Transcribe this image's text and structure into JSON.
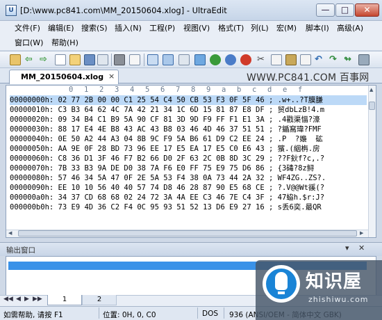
{
  "window": {
    "title": "[D:\\www.pc841.com\\MM_20150604.xlog] - UltraEdit",
    "app_icon": "U",
    "minimize_glyph": "—",
    "maximize_glyph": "□",
    "close_glyph": "✕"
  },
  "menu": {
    "row1": [
      "文件(F)",
      "编辑(E)",
      "搜索(S)",
      "插入(N)",
      "工程(P)",
      "视图(V)",
      "格式(T)",
      "列(L)",
      "宏(M)",
      "脚本(I)",
      "高级(A)"
    ],
    "row2": [
      "窗口(W)",
      "帮助(H)"
    ]
  },
  "toolbar": {
    "icons": [
      "new-file-icon",
      "back-arrow-icon",
      "forward-arrow-icon",
      "open-file-icon",
      "open-folder-icon",
      "save-icon",
      "print-icon",
      "print-preview-icon",
      "hex-mode-icon",
      "column-mode-icon",
      "find-icon",
      "find-next-icon",
      "replace-icon",
      "bookmark-icon",
      "fold-icon",
      "help-icon",
      "cut-icon",
      "copy-icon",
      "paste-icon",
      "undo-icon",
      "macro-record-icon",
      "macro-play-icon",
      "tools-icon"
    ]
  },
  "tab": {
    "label": "MM_20150604.xlog",
    "close_glyph": "×"
  },
  "watermark": "WWW.PC841.COM 百事网",
  "ruler": [
    "0",
    "1",
    "2",
    "3",
    "4",
    "5",
    "6",
    "7",
    "8",
    "9",
    "a",
    "b",
    "c",
    "d",
    "e",
    "f"
  ],
  "hex_rows": [
    {
      "addr": "00000000h:",
      "bytes": "02 77 2B 00 00 C1 25 54 C4 50 CB 53 F3 0F 5F 46",
      "text": "; .w+..?T膜膁"
    },
    {
      "addr": "00000010h:",
      "bytes": "C3 B3 64 62 4C 7A 42 21 34 1C 6D 15 81 87 E8 DF",
      "text": "; 贸dbLzB!4.m"
    },
    {
      "addr": "00000020h:",
      "bytes": "09 34 B4 C1 B9 5A 90 CF 81 3D 9D F9 FF F1 E1 3A",
      "text": "; .4戳渠愊?濠"
    },
    {
      "addr": "00000030h:",
      "bytes": "88 17 E4 4E B8 43 AC 43 B8 03 46 4D 46 37 51 51",
      "text": "; ?鍎窩瑋?FMF"
    },
    {
      "addr": "00000040h:",
      "bytes": "0E 50 A2 44 A3 04 8B 9C F9 5A B6 61 D9 C2 EE 24",
      "text": "; .P  ?嬝  砿"
    },
    {
      "addr": "00000050h:",
      "bytes": "AA 9E 0F 28 BD 73 96 EE 17 E5 EA 17 E5 C0 E6 43",
      "text": "; 獱.(絪栴.房"
    },
    {
      "addr": "00000060h:",
      "bytes": "C8 36 D1 3F 46 F7 B2 66 D0 2F 63 2C 0B 8D 3C 29",
      "text": "; ??F鈥f?c,.?"
    },
    {
      "addr": "00000070h:",
      "bytes": "7B 33 B3 9A DE D0 38 7A F6 E0 FF 75 E9 75 D6 86",
      "text": "; {3碡?8z鲟"
    },
    {
      "addr": "00000080h:",
      "bytes": "57 46 34 5A 47 0F 2E 5A 53 F4 38 0A 73 44 2A 32",
      "text": "; WF4ZG..ZS?."
    },
    {
      "addr": "00000090h:",
      "bytes": "EE 10 10 56 40 40 57 74 D8 46 28 87 90 E5 68 CE",
      "text": "; ?.V@@Wt豀(?"
    },
    {
      "addr": "000000a0h:",
      "bytes": "34 37 CD 68 68 02 24 72 3A 4A EE C3 46 7E C4 3F",
      "text": "; 47蛠h.$r:J?"
    },
    {
      "addr": "000000b0h:",
      "bytes": "73 E9 4D 36 C2 F4 0C 95 93 51 52 13 D6 E9 27 16",
      "text": "; s丢6奕.最QR"
    }
  ],
  "output": {
    "title": "输出窗口",
    "controls": "▾ ✕"
  },
  "sheet_tabs": [
    "1",
    "2"
  ],
  "sheet_nav": [
    "◀◀",
    "◀",
    "▶",
    "▶▶"
  ],
  "status": {
    "help": "如需帮助, 请按 F1",
    "position": "位置: 0H, 0, C0",
    "line_ending": "DOS",
    "encoding": "936  (ANSI/OEM - 简体中文 GBK)"
  },
  "logo": {
    "text": "知识屋",
    "url": "zhishiwu.com"
  }
}
